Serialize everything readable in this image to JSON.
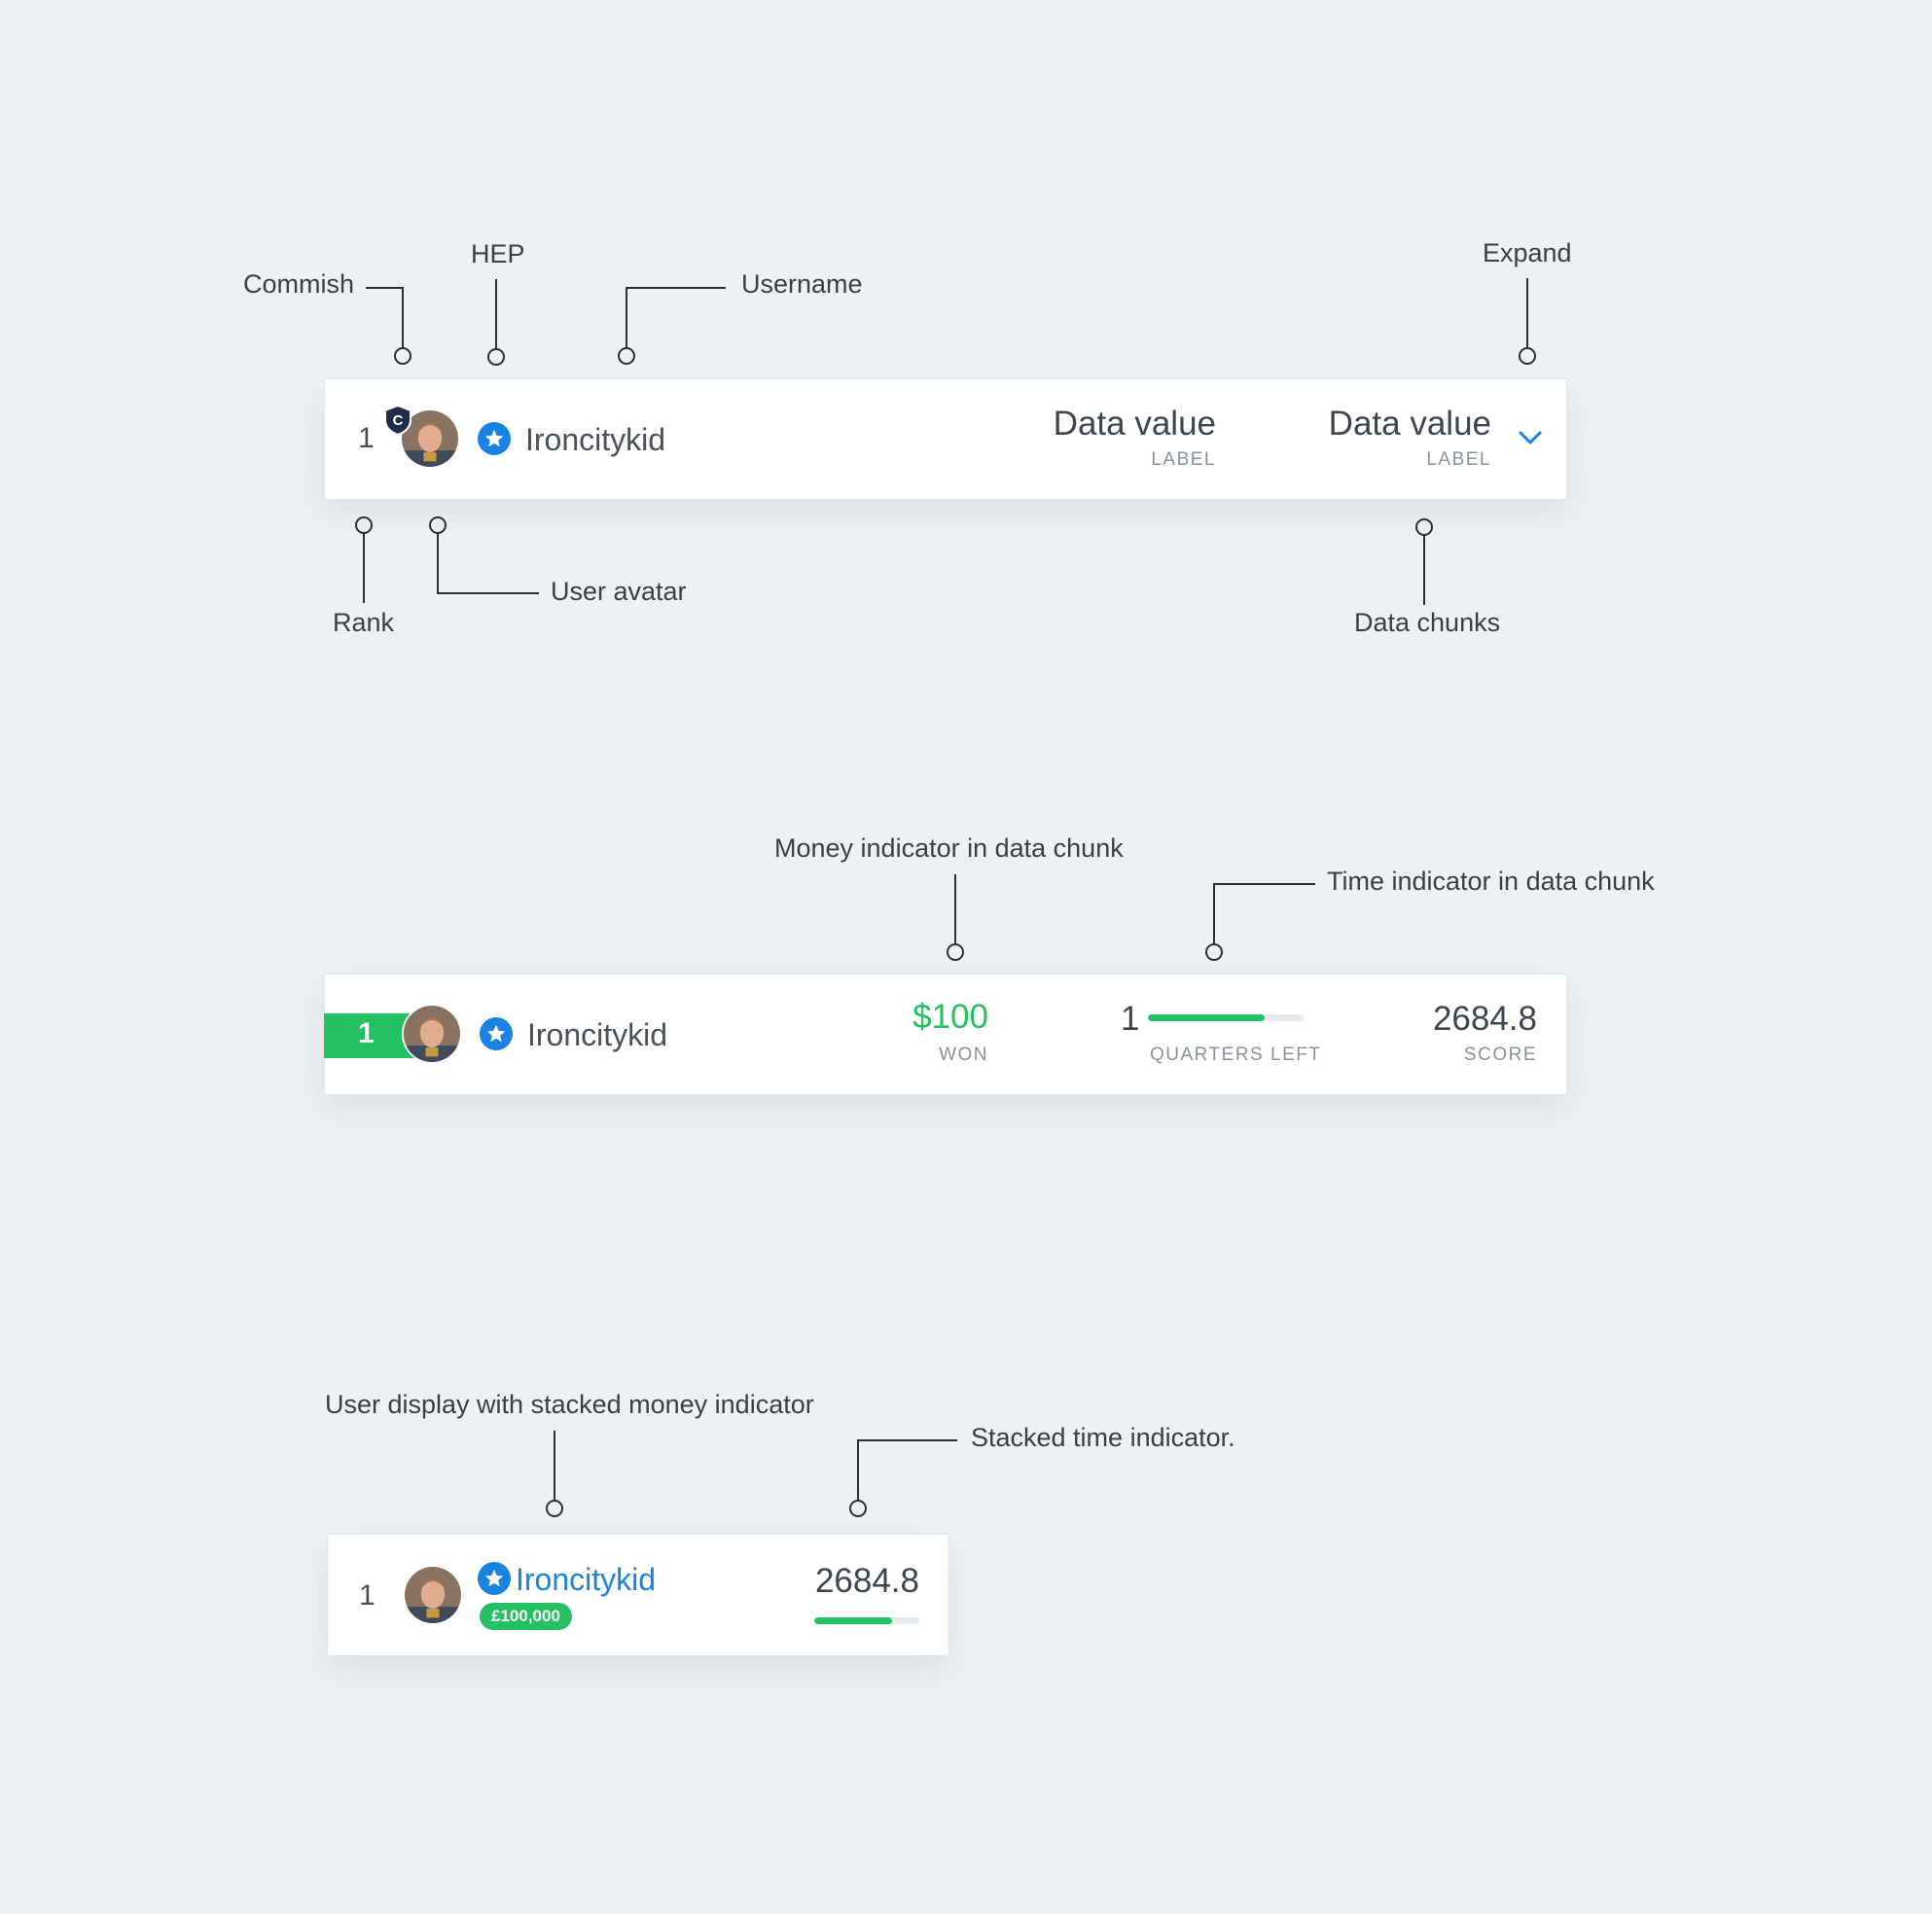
{
  "callouts": {
    "commish": "Commish",
    "hep": "HEP",
    "username": "Username",
    "expand": "Expand",
    "rank": "Rank",
    "user_avatar": "User avatar",
    "data_chunks": "Data chunks",
    "money_indicator": "Money indicator in data chunk",
    "time_indicator": "Time indicator in data chunk",
    "stacked_money": "User display with stacked money indicator",
    "stacked_time": "Stacked time indicator."
  },
  "row1": {
    "rank": "1",
    "commish_badge": "C",
    "username": "Ironcitykid",
    "chunks": [
      {
        "value": "Data value",
        "label": "LABEL"
      },
      {
        "value": "Data value",
        "label": "LABEL"
      }
    ],
    "expand_icon": "chevron-down-icon"
  },
  "row2": {
    "rank": "1",
    "username": "Ironcitykid",
    "money": {
      "value": "$100",
      "label": "WON"
    },
    "time": {
      "value": "1",
      "label": "QUARTERS LEFT",
      "progress": 0.75
    },
    "score": {
      "value": "2684.8",
      "label": "SCORE"
    }
  },
  "row3": {
    "rank": "1",
    "username": "Ironcitykid",
    "money_badge": "£100,000",
    "score": "2684.8",
    "progress": 0.74
  },
  "colors": {
    "background": "#edf0f4",
    "accent_blue": "#1a82e2",
    "money_green": "#23c162",
    "commish_navy": "#1e2e4a"
  },
  "icons": {
    "hep": "star-badge-icon",
    "commish": "shield-icon",
    "expand": "chevron-down-icon"
  }
}
